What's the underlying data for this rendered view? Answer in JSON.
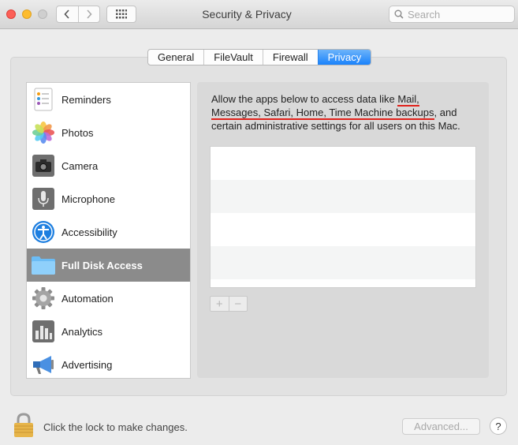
{
  "window": {
    "title": "Security & Privacy"
  },
  "toolbar": {
    "search_placeholder": "Search"
  },
  "tabs": [
    {
      "label": "General",
      "active": false
    },
    {
      "label": "FileVault",
      "active": false
    },
    {
      "label": "Firewall",
      "active": false
    },
    {
      "label": "Privacy",
      "active": true
    }
  ],
  "sidebar": {
    "items": [
      {
        "label": "Reminders",
        "icon": "reminders-icon",
        "selected": false
      },
      {
        "label": "Photos",
        "icon": "photos-icon",
        "selected": false
      },
      {
        "label": "Camera",
        "icon": "camera-icon",
        "selected": false
      },
      {
        "label": "Microphone",
        "icon": "microphone-icon",
        "selected": false
      },
      {
        "label": "Accessibility",
        "icon": "accessibility-icon",
        "selected": false
      },
      {
        "label": "Full Disk Access",
        "icon": "folder-icon",
        "selected": true
      },
      {
        "label": "Automation",
        "icon": "gear-icon",
        "selected": false
      },
      {
        "label": "Analytics",
        "icon": "analytics-icon",
        "selected": false
      },
      {
        "label": "Advertising",
        "icon": "megaphone-icon",
        "selected": false
      }
    ]
  },
  "detail": {
    "desc_part1": "Allow the apps below to access data like ",
    "desc_link1": "Mail,",
    "desc_link2": "Messages, Safari, Home, Time Machine backups",
    "desc_part2": ", and certain administrative settings for all users on this Mac.",
    "add_label": "+",
    "remove_label": "−"
  },
  "footer": {
    "lock_text": "Click the lock to make changes.",
    "advanced_label": "Advanced...",
    "help_label": "?"
  },
  "colors": {
    "accent": "#1a82fb",
    "selection": "#8b8b8b",
    "underline": "#e0221b"
  }
}
